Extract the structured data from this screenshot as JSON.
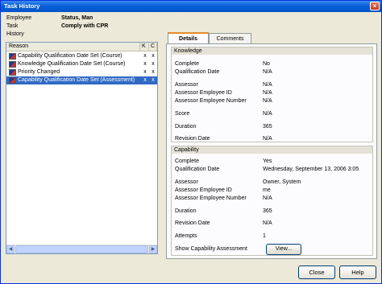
{
  "window": {
    "title": "Task History"
  },
  "info": {
    "employee_label": "Employee",
    "employee_value": "Status, Man",
    "task_label": "Task",
    "task_value": "Comply with CPR",
    "history_label": "History"
  },
  "grid": {
    "columns": [
      "Reason",
      "K",
      "C"
    ],
    "rows": [
      {
        "reason": "Capability Qualification Date Set (Course)",
        "k": "x",
        "c": "x"
      },
      {
        "reason": "Knowledge Qualification Date Set (Course)",
        "k": "x",
        "c": "x"
      },
      {
        "reason": "Priority Changed",
        "k": "x",
        "c": "x"
      },
      {
        "reason": "Capability Qualification Date Set (Assessment)",
        "k": "x",
        "c": "x"
      }
    ]
  },
  "tabs": {
    "details": "Details",
    "comments": "Comments"
  },
  "knowledge": {
    "title": "Knowledge",
    "fields": [
      {
        "label": "Complete",
        "value": "No"
      },
      {
        "label": "Qualification Date",
        "value": "N/A"
      },
      {
        "label": "Assessor",
        "value": "N/A"
      },
      {
        "label": "Assessor Employee ID",
        "value": "N/A"
      },
      {
        "label": "Assessor Employee Number",
        "value": "N/A"
      },
      {
        "label": "Score",
        "value": "N/A"
      },
      {
        "label": "Duration",
        "value": "365"
      },
      {
        "label": "Revision Date",
        "value": "N/A"
      }
    ]
  },
  "capability": {
    "title": "Capability",
    "fields": [
      {
        "label": "Complete",
        "value": "Yes"
      },
      {
        "label": "Qualification Date",
        "value": "Wednesday, September 13, 2006 3:05"
      },
      {
        "label": "Assessor",
        "value": "Owner, System"
      },
      {
        "label": "Assessor Employee ID",
        "value": "me"
      },
      {
        "label": "Assessor Employee Number",
        "value": "N/A"
      },
      {
        "label": "Duration",
        "value": "365"
      },
      {
        "label": "Revision Date",
        "value": "N/A"
      },
      {
        "label": "Attempts",
        "value": "1"
      }
    ],
    "show_label": "Show Capability Assessment",
    "view_button": "View..."
  },
  "buttons": {
    "close": "Close",
    "help": "Help"
  }
}
